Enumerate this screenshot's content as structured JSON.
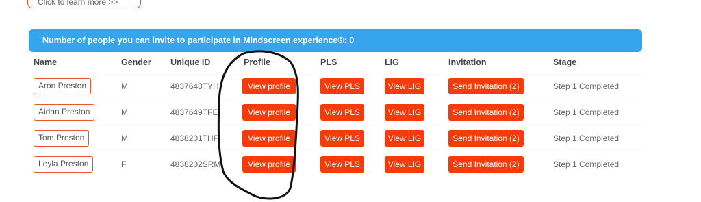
{
  "top_link": {
    "label": "Click to learn more >>"
  },
  "banner": {
    "text": "Number of people you can invite to participate in Mindscreen experience®: 0"
  },
  "table": {
    "headers": [
      "Name",
      "Gender",
      "Unique ID",
      "Profile",
      "PLS",
      "LIG",
      "Invitation",
      "Stage"
    ],
    "rows": [
      {
        "name": "Aron Preston",
        "gender": "M",
        "uid": "4837648TYH",
        "profile": "View profile",
        "pls": "View PLS",
        "lig": "View LIG",
        "invitation": "Send Invitation (2)",
        "stage": "Step 1 Completed"
      },
      {
        "name": "Aidan Preston",
        "gender": "M",
        "uid": "4837649TFE",
        "profile": "View profile",
        "pls": "View PLS",
        "lig": "View LIG",
        "invitation": "Send Invitation (2)",
        "stage": "Step 1 Completed"
      },
      {
        "name": "Tom Preston",
        "gender": "M",
        "uid": "4838201THF",
        "profile": "View profile",
        "pls": "View PLS",
        "lig": "View LIG",
        "invitation": "Send Invitation (2)",
        "stage": "Step 1 Completed"
      },
      {
        "name": "Leyla Preston",
        "gender": "F",
        "uid": "4838202SRM",
        "profile": "View profile",
        "pls": "View PLS",
        "lig": "View LIG",
        "invitation": "Send Invitation (2)",
        "stage": "Step 1 Completed"
      }
    ]
  },
  "colors": {
    "accent": "#f53a0c",
    "banner": "#37a4ee",
    "outline": "#f0532b"
  }
}
